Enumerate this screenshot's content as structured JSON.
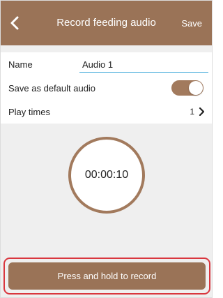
{
  "header": {
    "title": "Record feeding audio",
    "save_label": "Save",
    "back_icon": "chevron-left-icon"
  },
  "form": {
    "name_label": "Name",
    "name_value": "Audio 1",
    "default_label": "Save as default audio",
    "default_on": true,
    "play_times_label": "Play times",
    "play_times_value": "1",
    "play_times_icon": "chevron-right-icon"
  },
  "timer": {
    "value": "00:00:10"
  },
  "record_button": {
    "label": "Press and hold to record"
  },
  "colors": {
    "brand": "#9a7357",
    "toggle": "#a27a5d",
    "input_underline": "#3fa9d9",
    "highlight": "#d9363e"
  }
}
